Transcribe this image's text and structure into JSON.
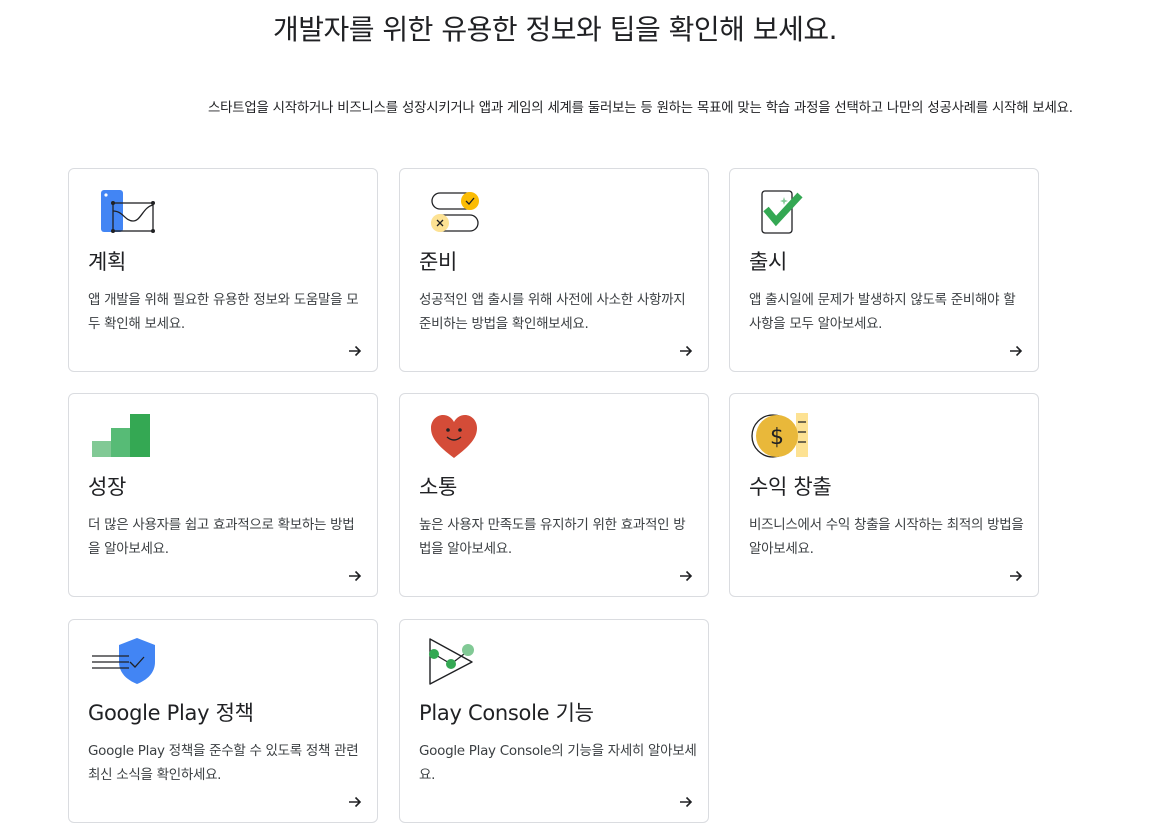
{
  "header": {
    "title": "개발자를 위한 유용한 정보와 팁을 확인해 보세요.",
    "subtitle": "스타트업을 시작하거나 비즈니스를 성장시키거나 앱과 게임의 세계를 둘러보는 등 원하는 목표에 맞는 학습 과정을 선택하고 나만의 성공사례를 시작해 보세요."
  },
  "cards": [
    {
      "title": "계획",
      "description": "앱 개발을 위해 필요한 유용한 정보와 도움말을 모두 확인해 보세요.",
      "icon": "planning-icon"
    },
    {
      "title": "준비",
      "description": "성공적인 앱 출시를 위해 사전에 사소한 사항까지 준비하는 방법을 확인해보세요.",
      "icon": "prepare-icon"
    },
    {
      "title": "출시",
      "description": "앱 출시일에 문제가 발생하지 않도록 준비해야 할 사항을 모두 알아보세요.",
      "icon": "launch-icon"
    },
    {
      "title": "성장",
      "description": "더 많은 사용자를 쉽고 효과적으로 확보하는 방법을 알아보세요.",
      "icon": "growth-icon"
    },
    {
      "title": "소통",
      "description": "높은 사용자 만족도를 유지하기 위한 효과적인 방법을 알아보세요.",
      "icon": "heart-icon"
    },
    {
      "title": "수익 창출",
      "description": "비즈니스에서 수익 창출을 시작하는 최적의 방법을 알아보세요.",
      "icon": "coin-icon"
    },
    {
      "title": "Google Play 정책",
      "description": "Google Play 정책을 준수할 수 있도록 정책 관련 최신 소식을 확인하세요.",
      "icon": "shield-icon"
    },
    {
      "title": "Play Console 기능",
      "description": "Google Play Console의 기능을 자세히 알아보세요.",
      "icon": "play-console-icon"
    }
  ],
  "colors": {
    "blue": "#4285f4",
    "green": "#34a853",
    "light_green": "#81c995",
    "yellow": "#fbbc04",
    "red": "#d44c38",
    "border": "#dadce0"
  }
}
